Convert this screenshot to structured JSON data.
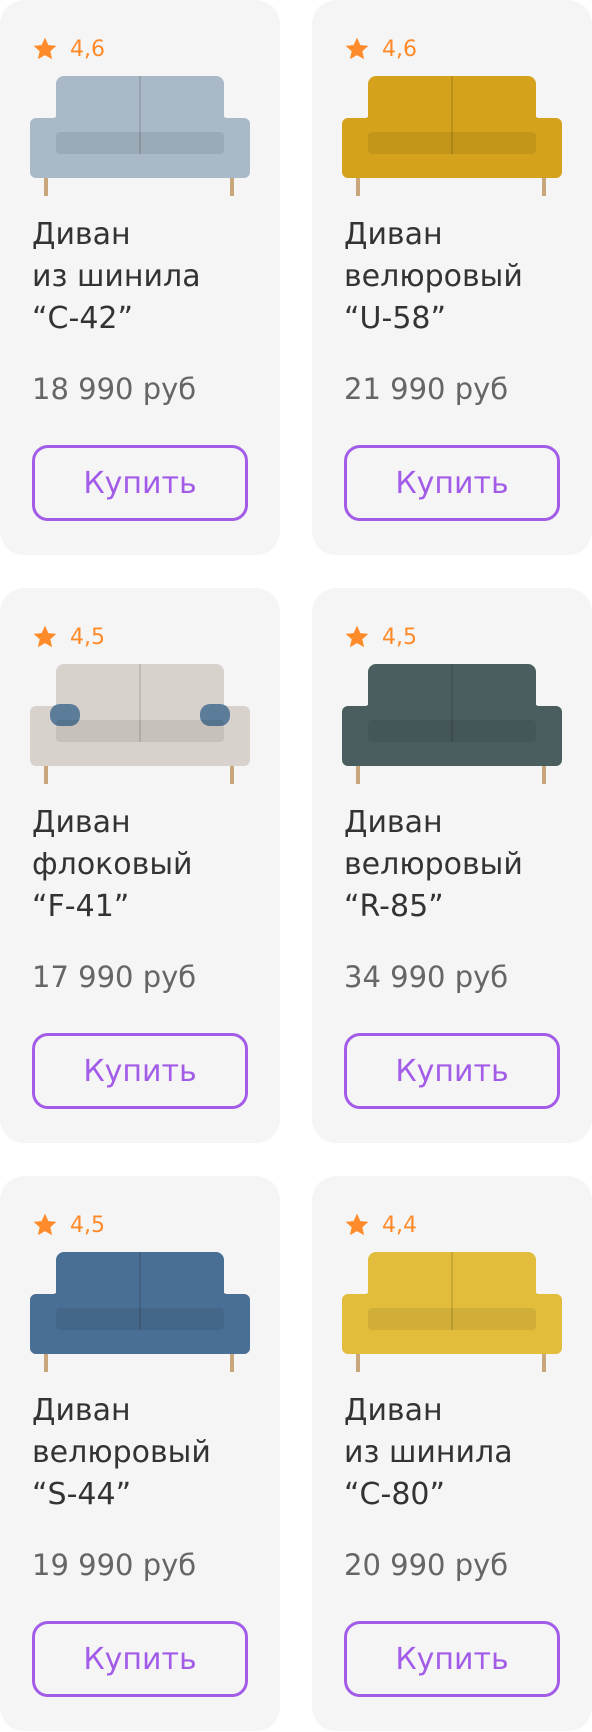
{
  "colors": {
    "accent": "#a25ce8",
    "rating": "#ff8a2a",
    "card_bg": "#f5f5f5"
  },
  "products": [
    {
      "rating": "4,6",
      "title": "Диван\nиз шинила\n“C-42”",
      "price": "18 990 руб",
      "buy_label": "Купить",
      "sofa_color": "#a9b9c7",
      "pillow_color": "#a9b9c7"
    },
    {
      "rating": "4,6",
      "title": "Диван\nвелюровый\n“U-58”",
      "price": "21 990 руб",
      "buy_label": "Купить",
      "sofa_color": "#d4a21c",
      "pillow_color": "#d4a21c"
    },
    {
      "rating": "4,5",
      "title": "Диван\nфлоковый\n“F-41”",
      "price": "17 990 руб",
      "buy_label": "Купить",
      "sofa_color": "#d8d2cc",
      "pillow_color": "#4f7393"
    },
    {
      "rating": "4,5",
      "title": "Диван\nвелюровый\n“R-85”",
      "price": "34 990 руб",
      "buy_label": "Купить",
      "sofa_color": "#4a5e5f",
      "pillow_color": "#4a5e5f"
    },
    {
      "rating": "4,5",
      "title": "Диван\nвелюровый\n“S-44”",
      "price": "19 990 руб",
      "buy_label": "Купить",
      "sofa_color": "#4a6f94",
      "pillow_color": "#4a6f94"
    },
    {
      "rating": "4,4",
      "title": "Диван\nиз шинила\n“C-80”",
      "price": "20 990 руб",
      "buy_label": "Купить",
      "sofa_color": "#e2bd3c",
      "pillow_color": "#e2bd3c"
    }
  ]
}
